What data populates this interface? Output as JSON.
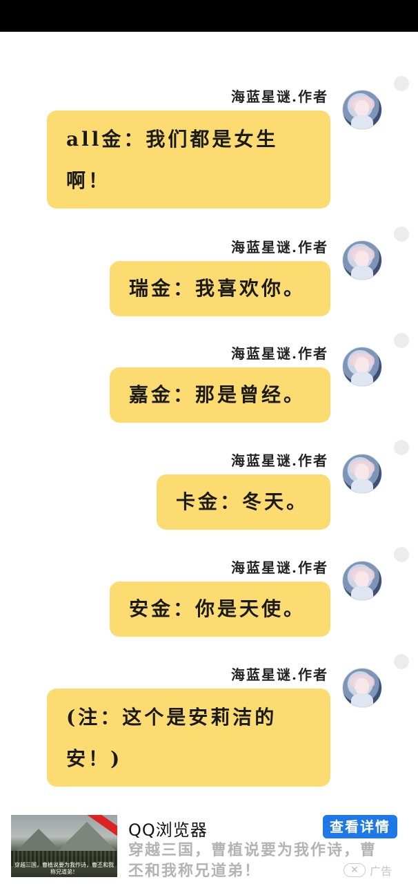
{
  "messages": [
    {
      "sender": "海蓝星谜.作者",
      "text_lines": [
        "all金：我们都是女生",
        "啊！"
      ]
    },
    {
      "sender": "海蓝星谜.作者",
      "text_lines": [
        "瑞金：我喜欢你。"
      ]
    },
    {
      "sender": "海蓝星谜.作者",
      "text_lines": [
        "嘉金：那是曾经。"
      ]
    },
    {
      "sender": "海蓝星谜.作者",
      "text_lines": [
        "卡金：冬天。"
      ]
    },
    {
      "sender": "海蓝星谜.作者",
      "text_lines": [
        "安金：你是天使。"
      ]
    },
    {
      "sender": "海蓝星谜.作者",
      "text_lines": [
        "(注：这个是安莉洁的",
        "安！)"
      ]
    }
  ],
  "ad": {
    "title": "QQ浏览器",
    "button_label": "查看详情",
    "description_lines": [
      "穿越三国，曹植说要为我作诗，曹",
      "丕和我称兄道弟！"
    ],
    "image_caption": "穿越三国，曹植说要为我作诗，曹丕和我称兄道弟！",
    "close_glyph": "✕",
    "label": "广告"
  },
  "colors": {
    "bubble": "#fcdb70",
    "ad_button": "#1e78e6"
  }
}
